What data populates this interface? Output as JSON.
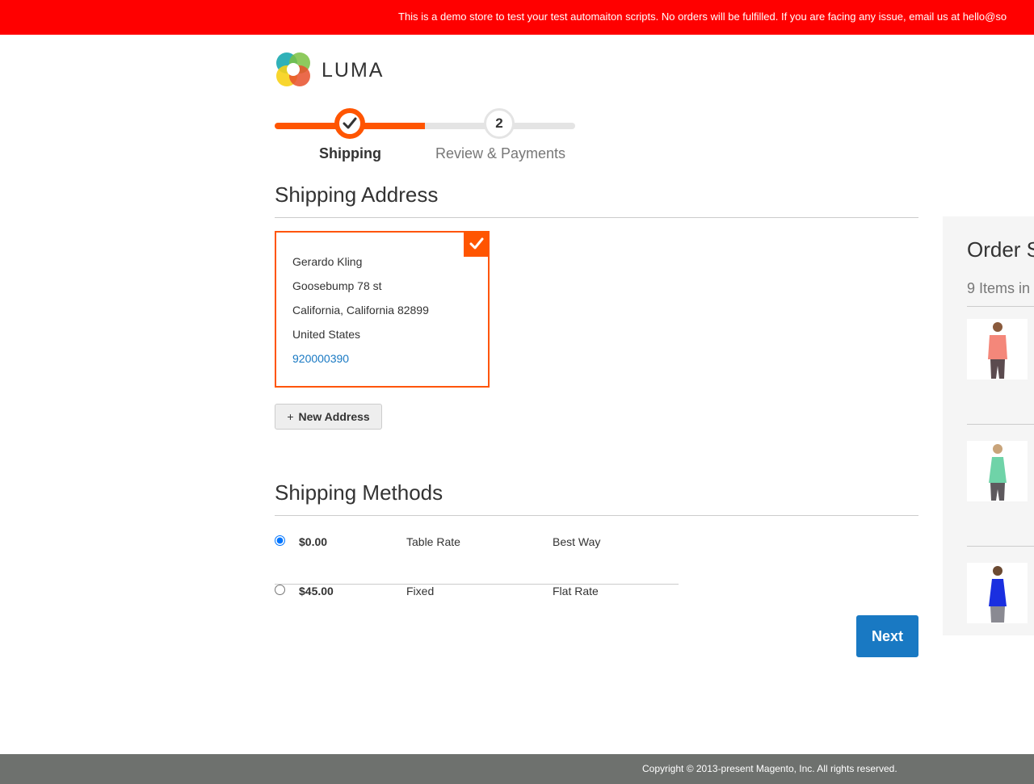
{
  "banner": {
    "text": "This is a demo store to test your test automaiton scripts. No orders will be fulfilled. If you are facing any issue, email us at hello@so"
  },
  "brand": {
    "name": "LUMA",
    "colors": {
      "accent": "#ff5501",
      "primary": "#1979c3",
      "banner": "#ff0000"
    }
  },
  "progress": {
    "steps": [
      {
        "label": "Shipping",
        "state": "complete",
        "icon": "checkmark-icon"
      },
      {
        "label": "Review & Payments",
        "number": "2",
        "state": "pending"
      }
    ]
  },
  "shipping_address": {
    "title": "Shipping Address",
    "selected_card": {
      "name": "Gerardo Kling",
      "street": "Goosebump 78 st",
      "city_region_zip": "California, California 82899",
      "country": "United States",
      "phone": "920000390",
      "selected": true
    },
    "new_address_icon": "+",
    "new_address_label": "New Address"
  },
  "shipping_methods": {
    "title": "Shipping Methods",
    "rows": [
      {
        "price": "$0.00",
        "method": "Table Rate",
        "carrier": "Best Way",
        "selected": true
      },
      {
        "price": "$45.00",
        "method": "Fixed",
        "carrier": "Flat Rate",
        "selected": false
      }
    ],
    "next_label": "Next"
  },
  "order_summary": {
    "title": "Order S",
    "items_count": "9 Items in",
    "items": [
      {
        "image": "coral-tee-product-image"
      },
      {
        "image": "mint-tank-product-image"
      },
      {
        "image": "blue-tank-product-image"
      }
    ]
  },
  "footer": {
    "copyright": "Copyright © 2013-present Magento, Inc. All rights reserved."
  }
}
